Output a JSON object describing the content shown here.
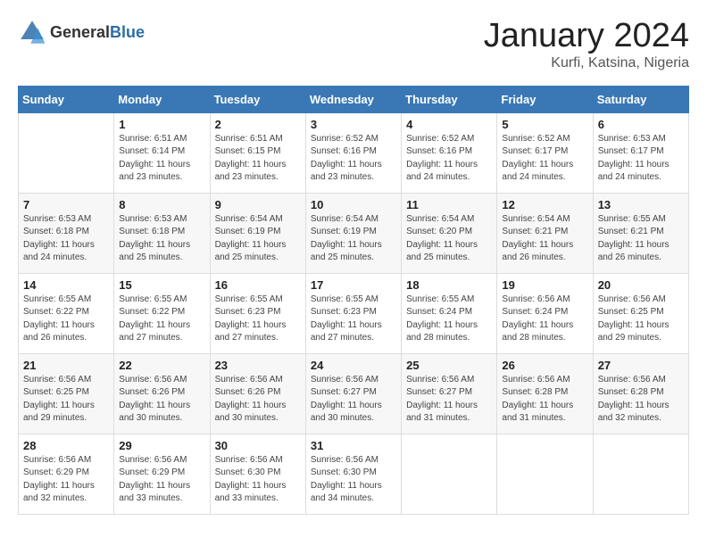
{
  "header": {
    "logo_general": "General",
    "logo_blue": "Blue",
    "month_title": "January 2024",
    "location": "Kurfi, Katsina, Nigeria"
  },
  "days_of_week": [
    "Sunday",
    "Monday",
    "Tuesday",
    "Wednesday",
    "Thursday",
    "Friday",
    "Saturday"
  ],
  "weeks": [
    [
      {
        "day": "",
        "sunrise": "",
        "sunset": "",
        "daylight": ""
      },
      {
        "day": "1",
        "sunrise": "Sunrise: 6:51 AM",
        "sunset": "Sunset: 6:14 PM",
        "daylight": "Daylight: 11 hours and 23 minutes."
      },
      {
        "day": "2",
        "sunrise": "Sunrise: 6:51 AM",
        "sunset": "Sunset: 6:15 PM",
        "daylight": "Daylight: 11 hours and 23 minutes."
      },
      {
        "day": "3",
        "sunrise": "Sunrise: 6:52 AM",
        "sunset": "Sunset: 6:16 PM",
        "daylight": "Daylight: 11 hours and 23 minutes."
      },
      {
        "day": "4",
        "sunrise": "Sunrise: 6:52 AM",
        "sunset": "Sunset: 6:16 PM",
        "daylight": "Daylight: 11 hours and 24 minutes."
      },
      {
        "day": "5",
        "sunrise": "Sunrise: 6:52 AM",
        "sunset": "Sunset: 6:17 PM",
        "daylight": "Daylight: 11 hours and 24 minutes."
      },
      {
        "day": "6",
        "sunrise": "Sunrise: 6:53 AM",
        "sunset": "Sunset: 6:17 PM",
        "daylight": "Daylight: 11 hours and 24 minutes."
      }
    ],
    [
      {
        "day": "7",
        "sunrise": "Sunrise: 6:53 AM",
        "sunset": "Sunset: 6:18 PM",
        "daylight": "Daylight: 11 hours and 24 minutes."
      },
      {
        "day": "8",
        "sunrise": "Sunrise: 6:53 AM",
        "sunset": "Sunset: 6:18 PM",
        "daylight": "Daylight: 11 hours and 25 minutes."
      },
      {
        "day": "9",
        "sunrise": "Sunrise: 6:54 AM",
        "sunset": "Sunset: 6:19 PM",
        "daylight": "Daylight: 11 hours and 25 minutes."
      },
      {
        "day": "10",
        "sunrise": "Sunrise: 6:54 AM",
        "sunset": "Sunset: 6:19 PM",
        "daylight": "Daylight: 11 hours and 25 minutes."
      },
      {
        "day": "11",
        "sunrise": "Sunrise: 6:54 AM",
        "sunset": "Sunset: 6:20 PM",
        "daylight": "Daylight: 11 hours and 25 minutes."
      },
      {
        "day": "12",
        "sunrise": "Sunrise: 6:54 AM",
        "sunset": "Sunset: 6:21 PM",
        "daylight": "Daylight: 11 hours and 26 minutes."
      },
      {
        "day": "13",
        "sunrise": "Sunrise: 6:55 AM",
        "sunset": "Sunset: 6:21 PM",
        "daylight": "Daylight: 11 hours and 26 minutes."
      }
    ],
    [
      {
        "day": "14",
        "sunrise": "Sunrise: 6:55 AM",
        "sunset": "Sunset: 6:22 PM",
        "daylight": "Daylight: 11 hours and 26 minutes."
      },
      {
        "day": "15",
        "sunrise": "Sunrise: 6:55 AM",
        "sunset": "Sunset: 6:22 PM",
        "daylight": "Daylight: 11 hours and 27 minutes."
      },
      {
        "day": "16",
        "sunrise": "Sunrise: 6:55 AM",
        "sunset": "Sunset: 6:23 PM",
        "daylight": "Daylight: 11 hours and 27 minutes."
      },
      {
        "day": "17",
        "sunrise": "Sunrise: 6:55 AM",
        "sunset": "Sunset: 6:23 PM",
        "daylight": "Daylight: 11 hours and 27 minutes."
      },
      {
        "day": "18",
        "sunrise": "Sunrise: 6:55 AM",
        "sunset": "Sunset: 6:24 PM",
        "daylight": "Daylight: 11 hours and 28 minutes."
      },
      {
        "day": "19",
        "sunrise": "Sunrise: 6:56 AM",
        "sunset": "Sunset: 6:24 PM",
        "daylight": "Daylight: 11 hours and 28 minutes."
      },
      {
        "day": "20",
        "sunrise": "Sunrise: 6:56 AM",
        "sunset": "Sunset: 6:25 PM",
        "daylight": "Daylight: 11 hours and 29 minutes."
      }
    ],
    [
      {
        "day": "21",
        "sunrise": "Sunrise: 6:56 AM",
        "sunset": "Sunset: 6:25 PM",
        "daylight": "Daylight: 11 hours and 29 minutes."
      },
      {
        "day": "22",
        "sunrise": "Sunrise: 6:56 AM",
        "sunset": "Sunset: 6:26 PM",
        "daylight": "Daylight: 11 hours and 30 minutes."
      },
      {
        "day": "23",
        "sunrise": "Sunrise: 6:56 AM",
        "sunset": "Sunset: 6:26 PM",
        "daylight": "Daylight: 11 hours and 30 minutes."
      },
      {
        "day": "24",
        "sunrise": "Sunrise: 6:56 AM",
        "sunset": "Sunset: 6:27 PM",
        "daylight": "Daylight: 11 hours and 30 minutes."
      },
      {
        "day": "25",
        "sunrise": "Sunrise: 6:56 AM",
        "sunset": "Sunset: 6:27 PM",
        "daylight": "Daylight: 11 hours and 31 minutes."
      },
      {
        "day": "26",
        "sunrise": "Sunrise: 6:56 AM",
        "sunset": "Sunset: 6:28 PM",
        "daylight": "Daylight: 11 hours and 31 minutes."
      },
      {
        "day": "27",
        "sunrise": "Sunrise: 6:56 AM",
        "sunset": "Sunset: 6:28 PM",
        "daylight": "Daylight: 11 hours and 32 minutes."
      }
    ],
    [
      {
        "day": "28",
        "sunrise": "Sunrise: 6:56 AM",
        "sunset": "Sunset: 6:29 PM",
        "daylight": "Daylight: 11 hours and 32 minutes."
      },
      {
        "day": "29",
        "sunrise": "Sunrise: 6:56 AM",
        "sunset": "Sunset: 6:29 PM",
        "daylight": "Daylight: 11 hours and 33 minutes."
      },
      {
        "day": "30",
        "sunrise": "Sunrise: 6:56 AM",
        "sunset": "Sunset: 6:30 PM",
        "daylight": "Daylight: 11 hours and 33 minutes."
      },
      {
        "day": "31",
        "sunrise": "Sunrise: 6:56 AM",
        "sunset": "Sunset: 6:30 PM",
        "daylight": "Daylight: 11 hours and 34 minutes."
      },
      {
        "day": "",
        "sunrise": "",
        "sunset": "",
        "daylight": ""
      },
      {
        "day": "",
        "sunrise": "",
        "sunset": "",
        "daylight": ""
      },
      {
        "day": "",
        "sunrise": "",
        "sunset": "",
        "daylight": ""
      }
    ]
  ]
}
